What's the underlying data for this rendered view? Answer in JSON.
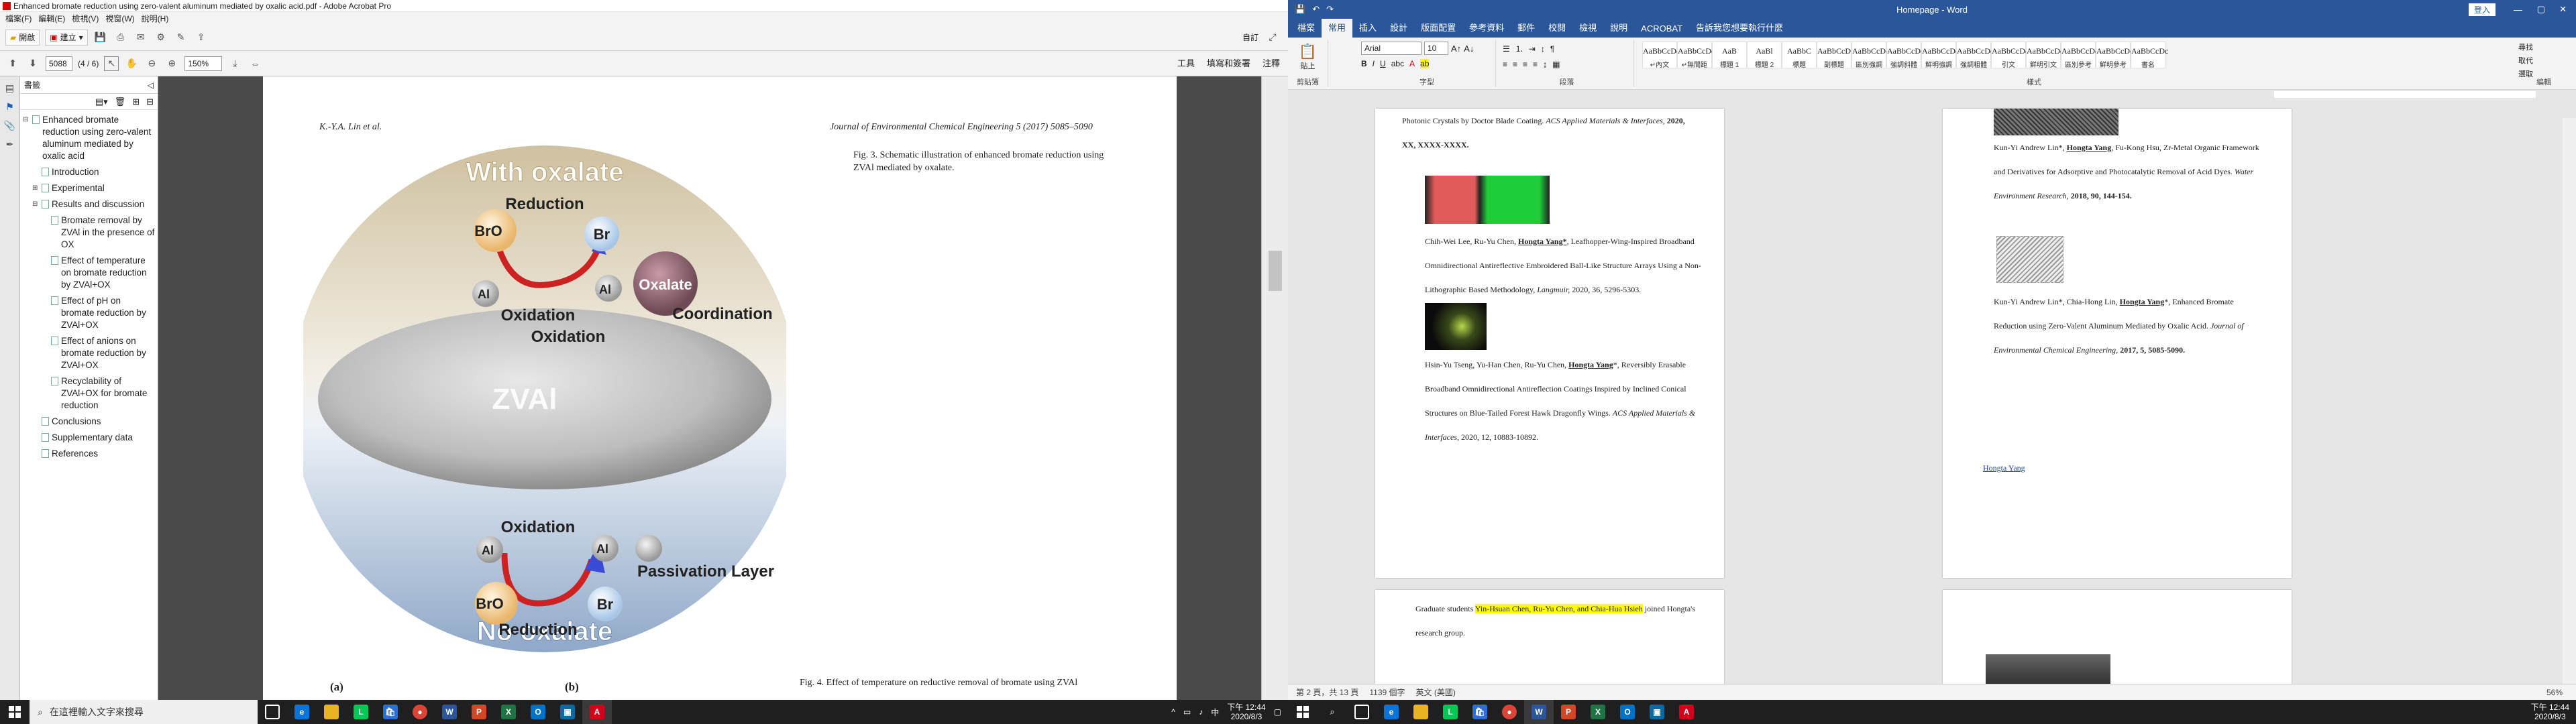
{
  "acrobat": {
    "title": "Enhanced bromate reduction using zero-valent aluminum mediated by oxalic acid.pdf - Adobe Acrobat Pro",
    "menu": [
      "檔案(F)",
      "編輯(E)",
      "檢視(V)",
      "視窗(W)",
      "說明(H)"
    ],
    "toolbar": {
      "open": "開啟",
      "create": "建立",
      "customize": "自訂"
    },
    "nav": {
      "page_value": "5088",
      "page_info": "(4 / 6)",
      "zoom": "150%"
    },
    "right_tools": [
      "工具",
      "填寫和簽署",
      "注釋"
    ],
    "bookmarks": {
      "title": "書籤",
      "items": [
        {
          "label": "Enhanced bromate reduction using zero-valent aluminum mediated by oxalic acid",
          "level": 0,
          "toggle": "⊟"
        },
        {
          "label": "Introduction",
          "level": 1,
          "toggle": ""
        },
        {
          "label": "Experimental",
          "level": 1,
          "toggle": "⊞"
        },
        {
          "label": "Results and discussion",
          "level": 1,
          "toggle": "⊟"
        },
        {
          "label": "Bromate removal by ZVAl in the presence of OX",
          "level": 2,
          "toggle": ""
        },
        {
          "label": "Effect of temperature on bromate reduction by ZVAl+OX",
          "level": 2,
          "toggle": ""
        },
        {
          "label": "Effect of pH on bromate reduction by ZVAl+OX",
          "level": 2,
          "toggle": ""
        },
        {
          "label": "Effect of anions on bromate reduction by ZVAl+OX",
          "level": 2,
          "toggle": ""
        },
        {
          "label": "Recyclability of ZVAl+OX for bromate reduction",
          "level": 2,
          "toggle": ""
        },
        {
          "label": "Conclusions",
          "level": 1,
          "toggle": ""
        },
        {
          "label": "Supplementary data",
          "level": 1,
          "toggle": ""
        },
        {
          "label": "References",
          "level": 1,
          "toggle": ""
        }
      ]
    },
    "page": {
      "header_left": "K.-Y.A. Lin et al.",
      "header_right": "Journal of Environmental Chemical Engineering 5 (2017) 5085–5090",
      "caption": "Fig. 3. Schematic illustration of enhanced bromate reduction using ZVAl mediated by oxalate.",
      "caption2": "Fig. 4. Effect of temperature on reductive removal of bromate using ZVAl",
      "label_a": "(a)",
      "label_b": "(b)"
    },
    "figure": {
      "with_oxalate": "With oxalate",
      "no_oxalate": "No oxalate",
      "reduction": "Reduction",
      "oxidation": "Oxidation",
      "coordination": "Coordination",
      "zval": "ZVAl",
      "bro3": "BrO",
      "br": "Br",
      "al0": "Al",
      "al3": "Al",
      "oxalate": "Oxalate",
      "passivation": "Passivation Layer"
    }
  },
  "taskbar_left": {
    "search_placeholder": "在這裡輸入文字來搜尋",
    "time": "下午 12:44",
    "date": "2020/8/3"
  },
  "word": {
    "title": "Homepage - Word",
    "signin": "登入",
    "tabs": [
      "檔案",
      "常用",
      "插入",
      "設計",
      "版面配置",
      "參考資料",
      "郵件",
      "校閱",
      "檢視",
      "說明",
      "ACROBAT",
      "告訴我您想要執行什麼"
    ],
    "active_tab": "常用",
    "font_name": "Arial",
    "font_size": "10",
    "clipboard": "剪貼簿",
    "font_group": "字型",
    "para_group": "段落",
    "styles_group": "樣式",
    "edit_group": "編輯",
    "paste": "貼上",
    "styles": [
      {
        "sample": "AaBbCcDc",
        "name": "↵內文"
      },
      {
        "sample": "AaBbCcDc",
        "name": "↵無間距"
      },
      {
        "sample": "AaB",
        "name": "標題 1"
      },
      {
        "sample": "AaBl",
        "name": "標題 2"
      },
      {
        "sample": "AaBbC",
        "name": "標題"
      },
      {
        "sample": "AaBbCcD",
        "name": "副標題"
      },
      {
        "sample": "AaBbCcDc",
        "name": "區別強調"
      },
      {
        "sample": "AaBbCcDc",
        "name": "強調斜體"
      },
      {
        "sample": "AaBbCcDc",
        "name": "鮮明強調"
      },
      {
        "sample": "AaBbCcDc",
        "name": "強調粗體"
      },
      {
        "sample": "AaBbCcDc",
        "name": "引文"
      },
      {
        "sample": "AaBbCcDc",
        "name": "鮮明引文"
      },
      {
        "sample": "AaBbCcDc",
        "name": "區別參考"
      },
      {
        "sample": "AaBbCcDc",
        "name": "鮮明參考"
      },
      {
        "sample": "AaBbCcDc",
        "name": "書名"
      }
    ],
    "edit_items": [
      "尋找",
      "取代",
      "選取"
    ],
    "left_page": {
      "ref1_a": "Photonic Crystals by Doctor Blade Coating.",
      "ref1_j": "ACS Applied Materials & Interfaces,",
      "ref1_b": "2020, XX, XXXX-XXXX.",
      "ref2_pre": "Chih-Wei Lee, Ru-Yu Chen,",
      "ref2_name": "Hongta Yang*",
      "ref2_post": ", Leafhopper-Wing-Inspired Broadband Omnidirectional Antireflective Embroidered Ball-Like Structure Arrays Using a Non-Lithographic Based Methodology,",
      "ref2_j": "Langmuir,",
      "ref2_end": "2020, 36, 5296-5303.",
      "ref3_pre": "Hsin-Yu Tseng, Yu-Han Chen, Ru-Yu Chen,",
      "ref3_name": "Hongta Yang",
      "ref3_post": "*, Reversibly Erasable Broadband Omnidirectional Antireflection Coatings Inspired by Inclined Conical Structures on Blue-Tailed Forest Hawk Dragonfly Wings.",
      "ref3_j": "ACS Applied Materials & Interfaces,",
      "ref3_end": "2020, 12, 10883-10892.",
      "grad_pre": "Graduate students",
      "grad_names": "Yin-Hsuan Chen, Ru-Yu Chen, and Chia-Hua Hsieh",
      "grad_post": "joined Hongta's research group."
    },
    "right_page": {
      "ref4_pre": "Kun-Yi Andrew Lin*,",
      "ref4_name": "Hongta Yang",
      "ref4_post": ", Fu-Kong Hsu, Zr-Metal Organic Framework and Derivatives for Adsorptive and Photocatalytic Removal of Acid Dyes.",
      "ref4_j": "Water Environment Research,",
      "ref4_end": "2018, 90, 144-154.",
      "ref5_pre": "Kun-Yi Andrew Lin*, Chia-Hong Lin,",
      "ref5_name": "Hongta Yang",
      "ref5_post": "*, Enhanced Bromate Reduction using Zero-Valent Aluminum Mediated by Oxalic Acid.",
      "ref5_j": "Journal of Environmental Chemical Engineering,",
      "ref5_end": "2017, 5, 5085-5090.",
      "link": "Hongta Yang"
    },
    "status": {
      "page": "第 2 頁，共 13 頁",
      "words": "1139 個字",
      "lang": "英文 (美國)",
      "zoom": "56%"
    },
    "time": "下午 12:44",
    "date": "2020/8/3"
  }
}
